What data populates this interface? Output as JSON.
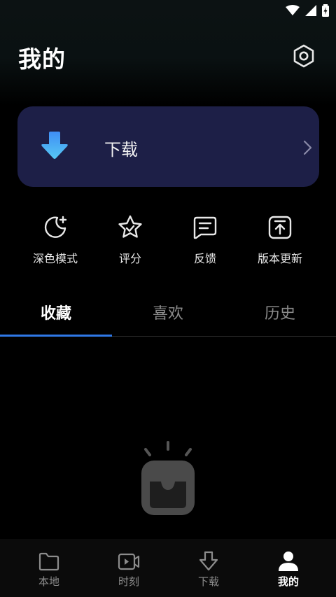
{
  "status_bar": {
    "icons": [
      "wifi-icon",
      "cellular-signal-icon",
      "battery-charging-icon"
    ]
  },
  "header": {
    "title": "我的",
    "settings_icon": "gear-hexagon-icon"
  },
  "download_card": {
    "label": "下载",
    "icon": "download-arrow-icon",
    "chevron": "chevron-right-icon",
    "background": "#1d1f47"
  },
  "shortcuts": [
    {
      "label": "深色模式",
      "icon": "dark-mode-moon-icon"
    },
    {
      "label": "评分",
      "icon": "star-icon"
    },
    {
      "label": "反馈",
      "icon": "feedback-message-icon"
    },
    {
      "label": "版本更新",
      "icon": "update-upload-icon"
    }
  ],
  "tabs": [
    {
      "label": "收藏",
      "active": true
    },
    {
      "label": "喜欢",
      "active": false
    },
    {
      "label": "历史",
      "active": false
    }
  ],
  "empty_state": {
    "icon": "empty-tv-inbox-icon",
    "text": ""
  },
  "bottom_nav": [
    {
      "label": "本地",
      "icon": "folder-icon",
      "active": false
    },
    {
      "label": "时刻",
      "icon": "video-icon",
      "active": false
    },
    {
      "label": "下载",
      "icon": "download-icon",
      "active": false
    },
    {
      "label": "我的",
      "icon": "profile-icon",
      "active": true
    }
  ],
  "colors": {
    "accent": "#2f78e6",
    "card": "#1d1f47",
    "background": "#000000"
  }
}
